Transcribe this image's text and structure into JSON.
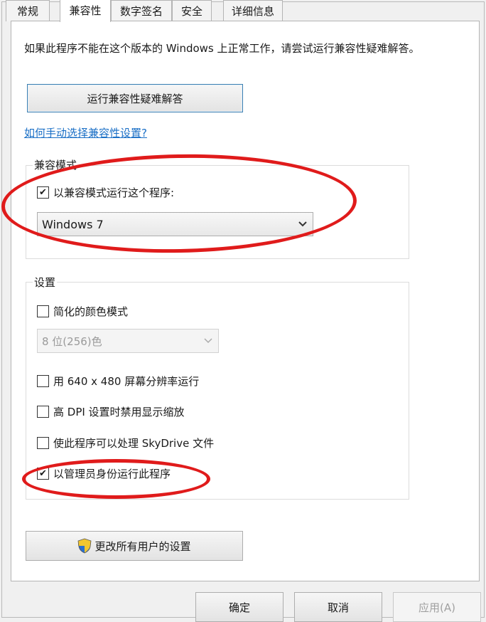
{
  "tabs": [
    "常规",
    "兼容性",
    "数字签名",
    "安全",
    "详细信息"
  ],
  "active_tab": "兼容性",
  "description": "如果此程序不能在这个版本的 Windows 上正常工作，请尝试运行兼容性疑难解答。",
  "troubleshoot_button": "运行兼容性疑难解答",
  "manual_link": "如何手动选择兼容性设置?",
  "compat_group": {
    "legend": "兼容模式",
    "checkbox_label": "以兼容模式运行这个程序:",
    "checked": true,
    "os_select_value": "Windows 7"
  },
  "settings_group": {
    "legend": "设置",
    "reduced_color_label": "简化的颜色模式",
    "reduced_color_checked": false,
    "color_select_value": "8 位(256)色",
    "res_640_label": "用 640 x 480 屏幕分辨率运行",
    "res_640_checked": false,
    "dpi_label": "高 DPI 设置时禁用显示缩放",
    "dpi_checked": false,
    "skydrive_label": "使此程序可以处理 SkyDrive 文件",
    "skydrive_checked": false,
    "admin_label": "以管理员身份运行此程序",
    "admin_checked": true
  },
  "all_users_button": "更改所有用户的设置",
  "footer": {
    "ok": "确定",
    "cancel": "取消",
    "apply": "应用(A)"
  },
  "colors": {
    "annotation_red": "#e01b1b",
    "link_blue": "#1a6fc6"
  },
  "icons": {
    "shield": "uac-shield-icon",
    "chevron": "chevron-down-icon",
    "check": "checkmark-icon"
  }
}
